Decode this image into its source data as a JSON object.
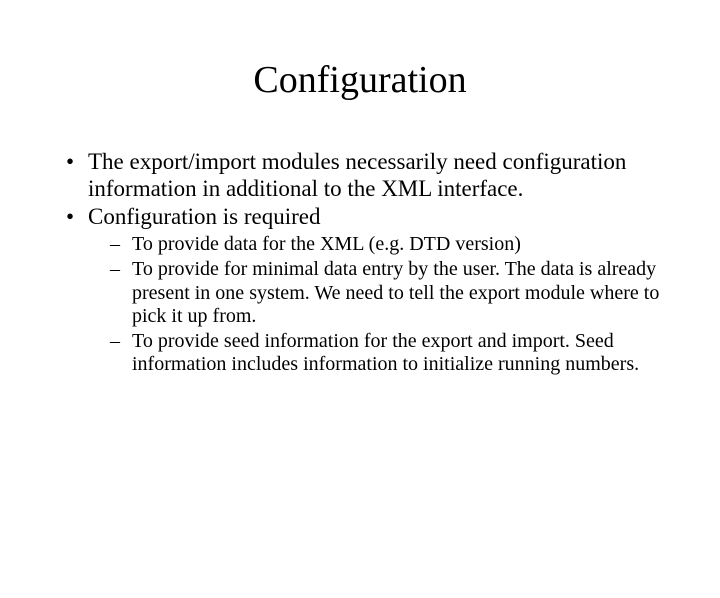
{
  "title": "Configuration",
  "bullets": [
    {
      "text": "The export/import modules necessarily need configuration information in additional to the XML interface."
    },
    {
      "text": "Configuration is required",
      "sub": [
        "To provide data for the XML (e.g. DTD version)",
        "To provide for minimal data entry by the user. The data is already present in one system. We need to tell the export module where to pick it up from.",
        "To provide seed information for the export and import. Seed information includes information to initialize running numbers."
      ]
    }
  ]
}
